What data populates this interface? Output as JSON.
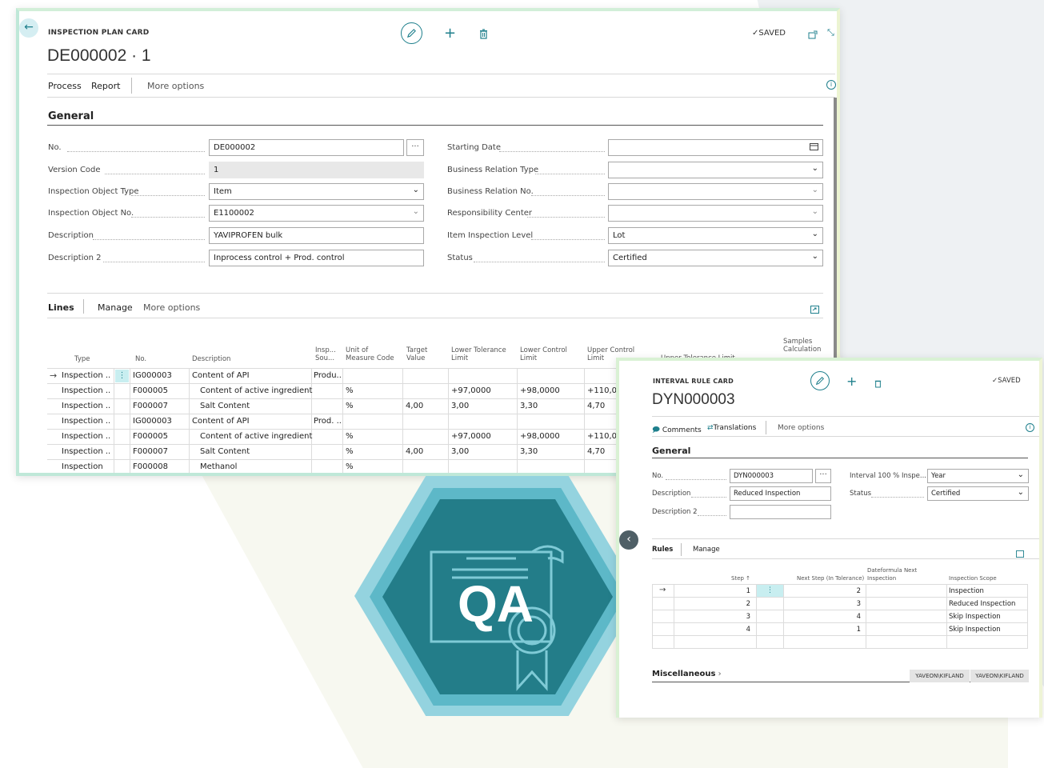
{
  "plan_card": {
    "caption": "INSPECTION PLAN CARD",
    "title": "DE000002 · 1",
    "saved": "✓SAVED",
    "actions": [
      "Process",
      "Report",
      "More options"
    ],
    "general_title": "General",
    "fields_left": [
      {
        "label": "No.",
        "value": "DE000002"
      },
      {
        "label": "Version Code",
        "value": "1"
      },
      {
        "label": "Inspection Object Type",
        "value": "Item"
      },
      {
        "label": "Inspection Object No.",
        "value": "E1100002"
      },
      {
        "label": "Description",
        "value": "YAVIPROFEN bulk"
      },
      {
        "label": "Description 2",
        "value": "Inprocess control + Prod. control"
      }
    ],
    "fields_right": [
      {
        "label": "Starting Date",
        "value": ""
      },
      {
        "label": "Business Relation Type",
        "value": ""
      },
      {
        "label": "Business Relation No.",
        "value": ""
      },
      {
        "label": "Responsibility Center",
        "value": ""
      },
      {
        "label": "Item Inspection Level",
        "value": "Lot"
      },
      {
        "label": "Status",
        "value": "Certified"
      }
    ],
    "lines_tabs": [
      "Lines",
      "Manage",
      "More options"
    ],
    "columns": [
      "Type",
      "No.",
      "Description",
      "Insp... Sou...",
      "Unit of Measure Code",
      "Target Value",
      "Lower Tolerance Limit",
      "Lower Control Limit",
      "Upper Control Limit",
      "Upper Tolerance Limit",
      "Samples Calculation"
    ],
    "rows": [
      {
        "type": "Inspection ...",
        "no": "IG000003",
        "desc": "Content of API",
        "src": "Produ...",
        "uom": "",
        "target": "",
        "ltl": "",
        "lcl": "",
        "ucl": ""
      },
      {
        "type": "Inspection ...",
        "no": "F000005",
        "desc": "Content of active ingredient",
        "src": "",
        "uom": "%",
        "target": "",
        "ltl": "+97,0000",
        "lcl": "+98,0000",
        "ucl": "+110,00"
      },
      {
        "type": "Inspection ...",
        "no": "F000007",
        "desc": "Salt Content",
        "src": "",
        "uom": "%",
        "target": "4,00",
        "ltl": "3,00",
        "lcl": "3,30",
        "ucl": "4,70"
      },
      {
        "type": "Inspection ...",
        "no": "IG000003",
        "desc": "Content of API",
        "src": "Prod. ...",
        "uom": "",
        "target": "",
        "ltl": "",
        "lcl": "",
        "ucl": ""
      },
      {
        "type": "Inspection ...",
        "no": "F000005",
        "desc": "Content of active ingredient",
        "src": "",
        "uom": "%",
        "target": "",
        "ltl": "+97,0000",
        "lcl": "+98,0000",
        "ucl": "+110,00"
      },
      {
        "type": "Inspection ...",
        "no": "F000007",
        "desc": "Salt Content",
        "src": "",
        "uom": "%",
        "target": "4,00",
        "ltl": "3,00",
        "lcl": "3,30",
        "ucl": "4,70"
      },
      {
        "type": "Inspection",
        "no": "F000008",
        "desc": "Methanol",
        "src": "",
        "uom": "%",
        "target": "",
        "ltl": "",
        "lcl": "",
        "ucl": ""
      }
    ]
  },
  "rule_card": {
    "caption": "INTERVAL RULE CARD",
    "title": "DYN000003",
    "saved": "✓SAVED",
    "actions": [
      "Comments",
      "Translations",
      "More options"
    ],
    "general_title": "General",
    "fields": [
      {
        "label": "No.",
        "value": "DYN000003"
      },
      {
        "label": "Description",
        "value": "Reduced Inspection"
      },
      {
        "label": "Description 2",
        "value": ""
      }
    ],
    "fields_right": [
      {
        "label": "Interval 100 % Inspe...",
        "value": "Year"
      },
      {
        "label": "Status",
        "value": "Certified"
      }
    ],
    "rules_tabs": [
      "Rules",
      "Manage"
    ],
    "columns": [
      "Step ↑",
      "Next Step (In Tolerance)",
      "Dateformula Next Inspection",
      "Inspection Scope"
    ],
    "rows": [
      {
        "step": "1",
        "next": "2",
        "formula": "",
        "scope": "Inspection"
      },
      {
        "step": "2",
        "next": "3",
        "formula": "",
        "scope": "Reduced Inspection"
      },
      {
        "step": "3",
        "next": "4",
        "formula": "",
        "scope": "Skip Inspection"
      },
      {
        "step": "4",
        "next": "1",
        "formula": "",
        "scope": "Skip Inspection"
      }
    ],
    "misc_title": "Miscellaneous",
    "misc_values": [
      "YAVEON\\KIFLAND",
      "YAVEON\\KIFLAND"
    ]
  },
  "badge": {
    "text": "QA"
  }
}
